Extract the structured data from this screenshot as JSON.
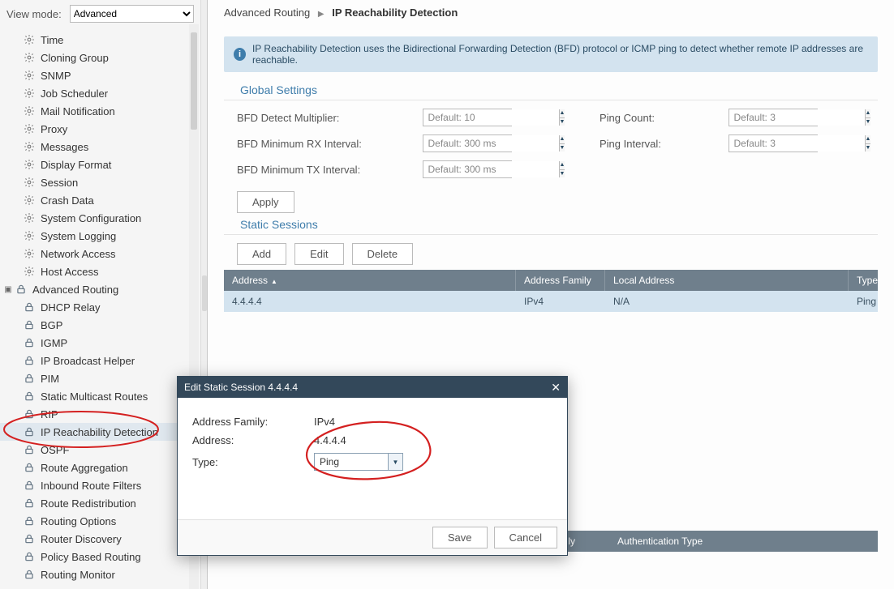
{
  "viewmode": {
    "label": "View mode:",
    "value": "Advanced"
  },
  "sidebar": {
    "sysItems": [
      {
        "label": "Time"
      },
      {
        "label": "Cloning Group"
      },
      {
        "label": "SNMP"
      },
      {
        "label": "Job Scheduler"
      },
      {
        "label": "Mail Notification"
      },
      {
        "label": "Proxy"
      },
      {
        "label": "Messages"
      },
      {
        "label": "Display Format"
      },
      {
        "label": "Session"
      },
      {
        "label": "Crash Data"
      },
      {
        "label": "System Configuration"
      },
      {
        "label": "System Logging"
      },
      {
        "label": "Network Access"
      },
      {
        "label": "Host Access"
      }
    ],
    "groupLabel": "Advanced Routing",
    "advItems": [
      {
        "label": "DHCP Relay"
      },
      {
        "label": "BGP"
      },
      {
        "label": "IGMP"
      },
      {
        "label": "IP Broadcast Helper"
      },
      {
        "label": "PIM"
      },
      {
        "label": "Static Multicast Routes"
      },
      {
        "label": "RIP"
      },
      {
        "label": "IP Reachability Detection",
        "selected": true
      },
      {
        "label": "OSPF"
      },
      {
        "label": "Route Aggregation"
      },
      {
        "label": "Inbound Route Filters"
      },
      {
        "label": "Route Redistribution"
      },
      {
        "label": "Routing Options"
      },
      {
        "label": "Router Discovery"
      },
      {
        "label": "Policy Based Routing"
      },
      {
        "label": "Routing Monitor"
      }
    ]
  },
  "breadcrumb": {
    "parent": "Advanced Routing",
    "current": "IP Reachability Detection"
  },
  "info": "IP Reachability Detection uses the Bidirectional Forwarding Detection (BFD) protocol or ICMP ping to detect whether remote IP addresses are reachable.",
  "sections": {
    "global": "Global Settings",
    "static": "Static Sessions"
  },
  "global": {
    "bfdMult": {
      "label": "BFD Detect Multiplier:",
      "placeholder": "Default: 10"
    },
    "bfdRx": {
      "label": "BFD Minimum RX Interval:",
      "placeholder": "Default: 300 ms"
    },
    "bfdTx": {
      "label": "BFD Minimum TX Interval:",
      "placeholder": "Default: 300 ms"
    },
    "pingCount": {
      "label": "Ping Count:",
      "placeholder": "Default: 3"
    },
    "pingInt": {
      "label": "Ping Interval:",
      "placeholder": "Default: 3"
    },
    "applyLabel": "Apply"
  },
  "actions": {
    "add": "Add",
    "edit": "Edit",
    "delete": "Delete"
  },
  "table": {
    "columns": {
      "address": "Address",
      "family": "Address Family",
      "local": "Local Address",
      "type": "Type"
    },
    "rows": [
      {
        "address": "4.4.4.4",
        "family": "IPv4",
        "local": "N/A",
        "type": "Ping"
      }
    ]
  },
  "lowerTable": {
    "columns": {
      "family": "amily",
      "auth": "Authentication Type"
    }
  },
  "dialog": {
    "title": "Edit Static Session 4.4.4.4",
    "fields": {
      "family": {
        "label": "Address Family:",
        "value": "IPv4"
      },
      "address": {
        "label": "Address:",
        "value": "4.4.4.4"
      },
      "type": {
        "label": "Type:",
        "value": "Ping"
      }
    },
    "save": "Save",
    "cancel": "Cancel"
  }
}
